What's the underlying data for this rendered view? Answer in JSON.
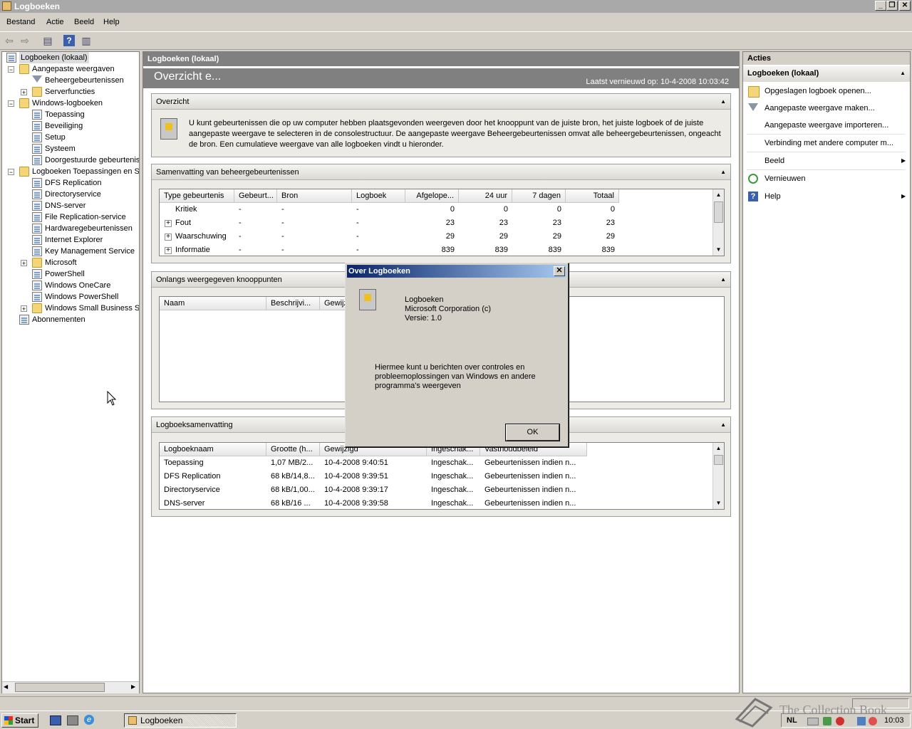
{
  "window": {
    "title": "Logboeken"
  },
  "menu": [
    "Bestand",
    "Actie",
    "Beeld",
    "Help"
  ],
  "tree": {
    "root": "Logboeken (lokaal)",
    "items": [
      {
        "label": "Aangepaste weergaven",
        "indent": 1,
        "toggle": "−",
        "icon": "folder"
      },
      {
        "label": "Beheergebeurtenissen",
        "indent": 2,
        "toggle": "",
        "icon": "filter"
      },
      {
        "label": "Serverfuncties",
        "indent": 2,
        "toggle": "+",
        "icon": "folder"
      },
      {
        "label": "Windows-logboeken",
        "indent": 1,
        "toggle": "−",
        "icon": "folder"
      },
      {
        "label": "Toepassing",
        "indent": 2,
        "toggle": "",
        "icon": "log"
      },
      {
        "label": "Beveiliging",
        "indent": 2,
        "toggle": "",
        "icon": "log"
      },
      {
        "label": "Setup",
        "indent": 2,
        "toggle": "",
        "icon": "log"
      },
      {
        "label": "Systeem",
        "indent": 2,
        "toggle": "",
        "icon": "log"
      },
      {
        "label": "Doorgestuurde gebeurtenis",
        "indent": 2,
        "toggle": "",
        "icon": "log"
      },
      {
        "label": "Logboeken Toepassingen en Se",
        "indent": 1,
        "toggle": "−",
        "icon": "folder"
      },
      {
        "label": "DFS Replication",
        "indent": 2,
        "toggle": "",
        "icon": "log"
      },
      {
        "label": "Directoryservice",
        "indent": 2,
        "toggle": "",
        "icon": "log"
      },
      {
        "label": "DNS-server",
        "indent": 2,
        "toggle": "",
        "icon": "log"
      },
      {
        "label": "File Replication-service",
        "indent": 2,
        "toggle": "",
        "icon": "log"
      },
      {
        "label": "Hardwaregebeurtenissen",
        "indent": 2,
        "toggle": "",
        "icon": "log"
      },
      {
        "label": "Internet Explorer",
        "indent": 2,
        "toggle": "",
        "icon": "log"
      },
      {
        "label": "Key Management Service",
        "indent": 2,
        "toggle": "",
        "icon": "log"
      },
      {
        "label": "Microsoft",
        "indent": 2,
        "toggle": "+",
        "icon": "folder"
      },
      {
        "label": "PowerShell",
        "indent": 2,
        "toggle": "",
        "icon": "log"
      },
      {
        "label": "Windows OneCare",
        "indent": 2,
        "toggle": "",
        "icon": "log"
      },
      {
        "label": "Windows PowerShell",
        "indent": 2,
        "toggle": "",
        "icon": "log"
      },
      {
        "label": "Windows Small Business Ser",
        "indent": 2,
        "toggle": "+",
        "icon": "folder"
      },
      {
        "label": "Abonnementen",
        "indent": 1,
        "toggle": "",
        "icon": "log"
      }
    ]
  },
  "center": {
    "header": "Logboeken (lokaal)",
    "title": "Overzicht e...",
    "refreshed": "Laatst vernieuwd op: 10-4-2008 10:03:42",
    "overview_title": "Overzicht",
    "overview_text": "U kunt gebeurtenissen die op uw computer hebben plaatsgevonden weergeven door het knooppunt van de juiste bron, het juiste logboek of de juiste aangepaste weergave te selecteren in de consolestructuur. De aangepaste weergave Beheergebeurtenissen omvat alle beheergebeurtenissen, ongeacht de bron. Een cumulatieve weergave van alle logboeken vindt u hieronder.",
    "summary_title": "Samenvatting van beheergebeurtenissen",
    "summary_columns": [
      "Type gebeurtenis",
      "Gebeurt...",
      "Bron",
      "Logboek",
      "Afgelope...",
      "24 uur",
      "7 dagen",
      "Totaal"
    ],
    "summary_rows": [
      {
        "expand": "",
        "cells": [
          "Kritiek",
          "-",
          "-",
          "-",
          "0",
          "0",
          "0",
          "0"
        ]
      },
      {
        "expand": "+",
        "cells": [
          "Fout",
          "-",
          "-",
          "-",
          "23",
          "23",
          "23",
          "23"
        ]
      },
      {
        "expand": "+",
        "cells": [
          "Waarschuwing",
          "-",
          "-",
          "-",
          "29",
          "29",
          "29",
          "29"
        ]
      },
      {
        "expand": "+",
        "cells": [
          "Informatie",
          "-",
          "-",
          "-",
          "839",
          "839",
          "839",
          "839"
        ]
      }
    ],
    "recent_title": "Onlangs weergegeven knooppunten",
    "recent_columns": [
      "Naam",
      "Beschrijvi...",
      "Gewijz"
    ],
    "logsummary_title": "Logboeksamenvatting",
    "logsummary_columns": [
      "Logboeknaam",
      "Grootte (h...",
      "Gewijzigd",
      "Ingeschak...",
      "Vasthoudbeleid"
    ],
    "logsummary_rows": [
      [
        "Toepassing",
        "1,07 MB/2...",
        "10-4-2008 9:40:51",
        "Ingeschak...",
        "Gebeurtenissen indien n..."
      ],
      [
        "DFS Replication",
        "68 kB/14,8...",
        "10-4-2008 9:39:51",
        "Ingeschak...",
        "Gebeurtenissen indien n..."
      ],
      [
        "Directoryservice",
        "68 kB/1,00...",
        "10-4-2008 9:39:17",
        "Ingeschak...",
        "Gebeurtenissen indien n..."
      ],
      [
        "DNS-server",
        "68 kB/16 ...",
        "10-4-2008 9:39:58",
        "Ingeschak...",
        "Gebeurtenissen indien n..."
      ]
    ]
  },
  "actions": {
    "header": "Acties",
    "subheader": "Logboeken (lokaal)",
    "items": [
      {
        "label": "Opgeslagen logboek openen...",
        "icon": "folder-open-icon",
        "sub": false
      },
      {
        "label": "Aangepaste weergave maken...",
        "icon": "filter-icon",
        "sub": false
      },
      {
        "label": "Aangepaste weergave importeren...",
        "icon": "",
        "sub": false
      },
      {
        "label": "Verbinding met andere computer m...",
        "icon": "",
        "sub": false
      },
      {
        "label": "Beeld",
        "icon": "",
        "sub": true
      },
      {
        "label": "Vernieuwen",
        "icon": "refresh-icon",
        "sub": false
      },
      {
        "label": "Help",
        "icon": "help-icon",
        "sub": true
      }
    ]
  },
  "dialog": {
    "title": "Over Logboeken",
    "product": "Logboeken",
    "company": "Microsoft Corporation (c)",
    "version": "Versie: 1.0",
    "description": "Hiermee kunt u berichten over controles en probleemoplossingen van Windows en andere programma's weergeven",
    "ok": "OK"
  },
  "taskbar": {
    "start": "Start",
    "task": "Logboeken",
    "lang": "NL",
    "clock": "10:03"
  },
  "watermark": "The Collection Book"
}
